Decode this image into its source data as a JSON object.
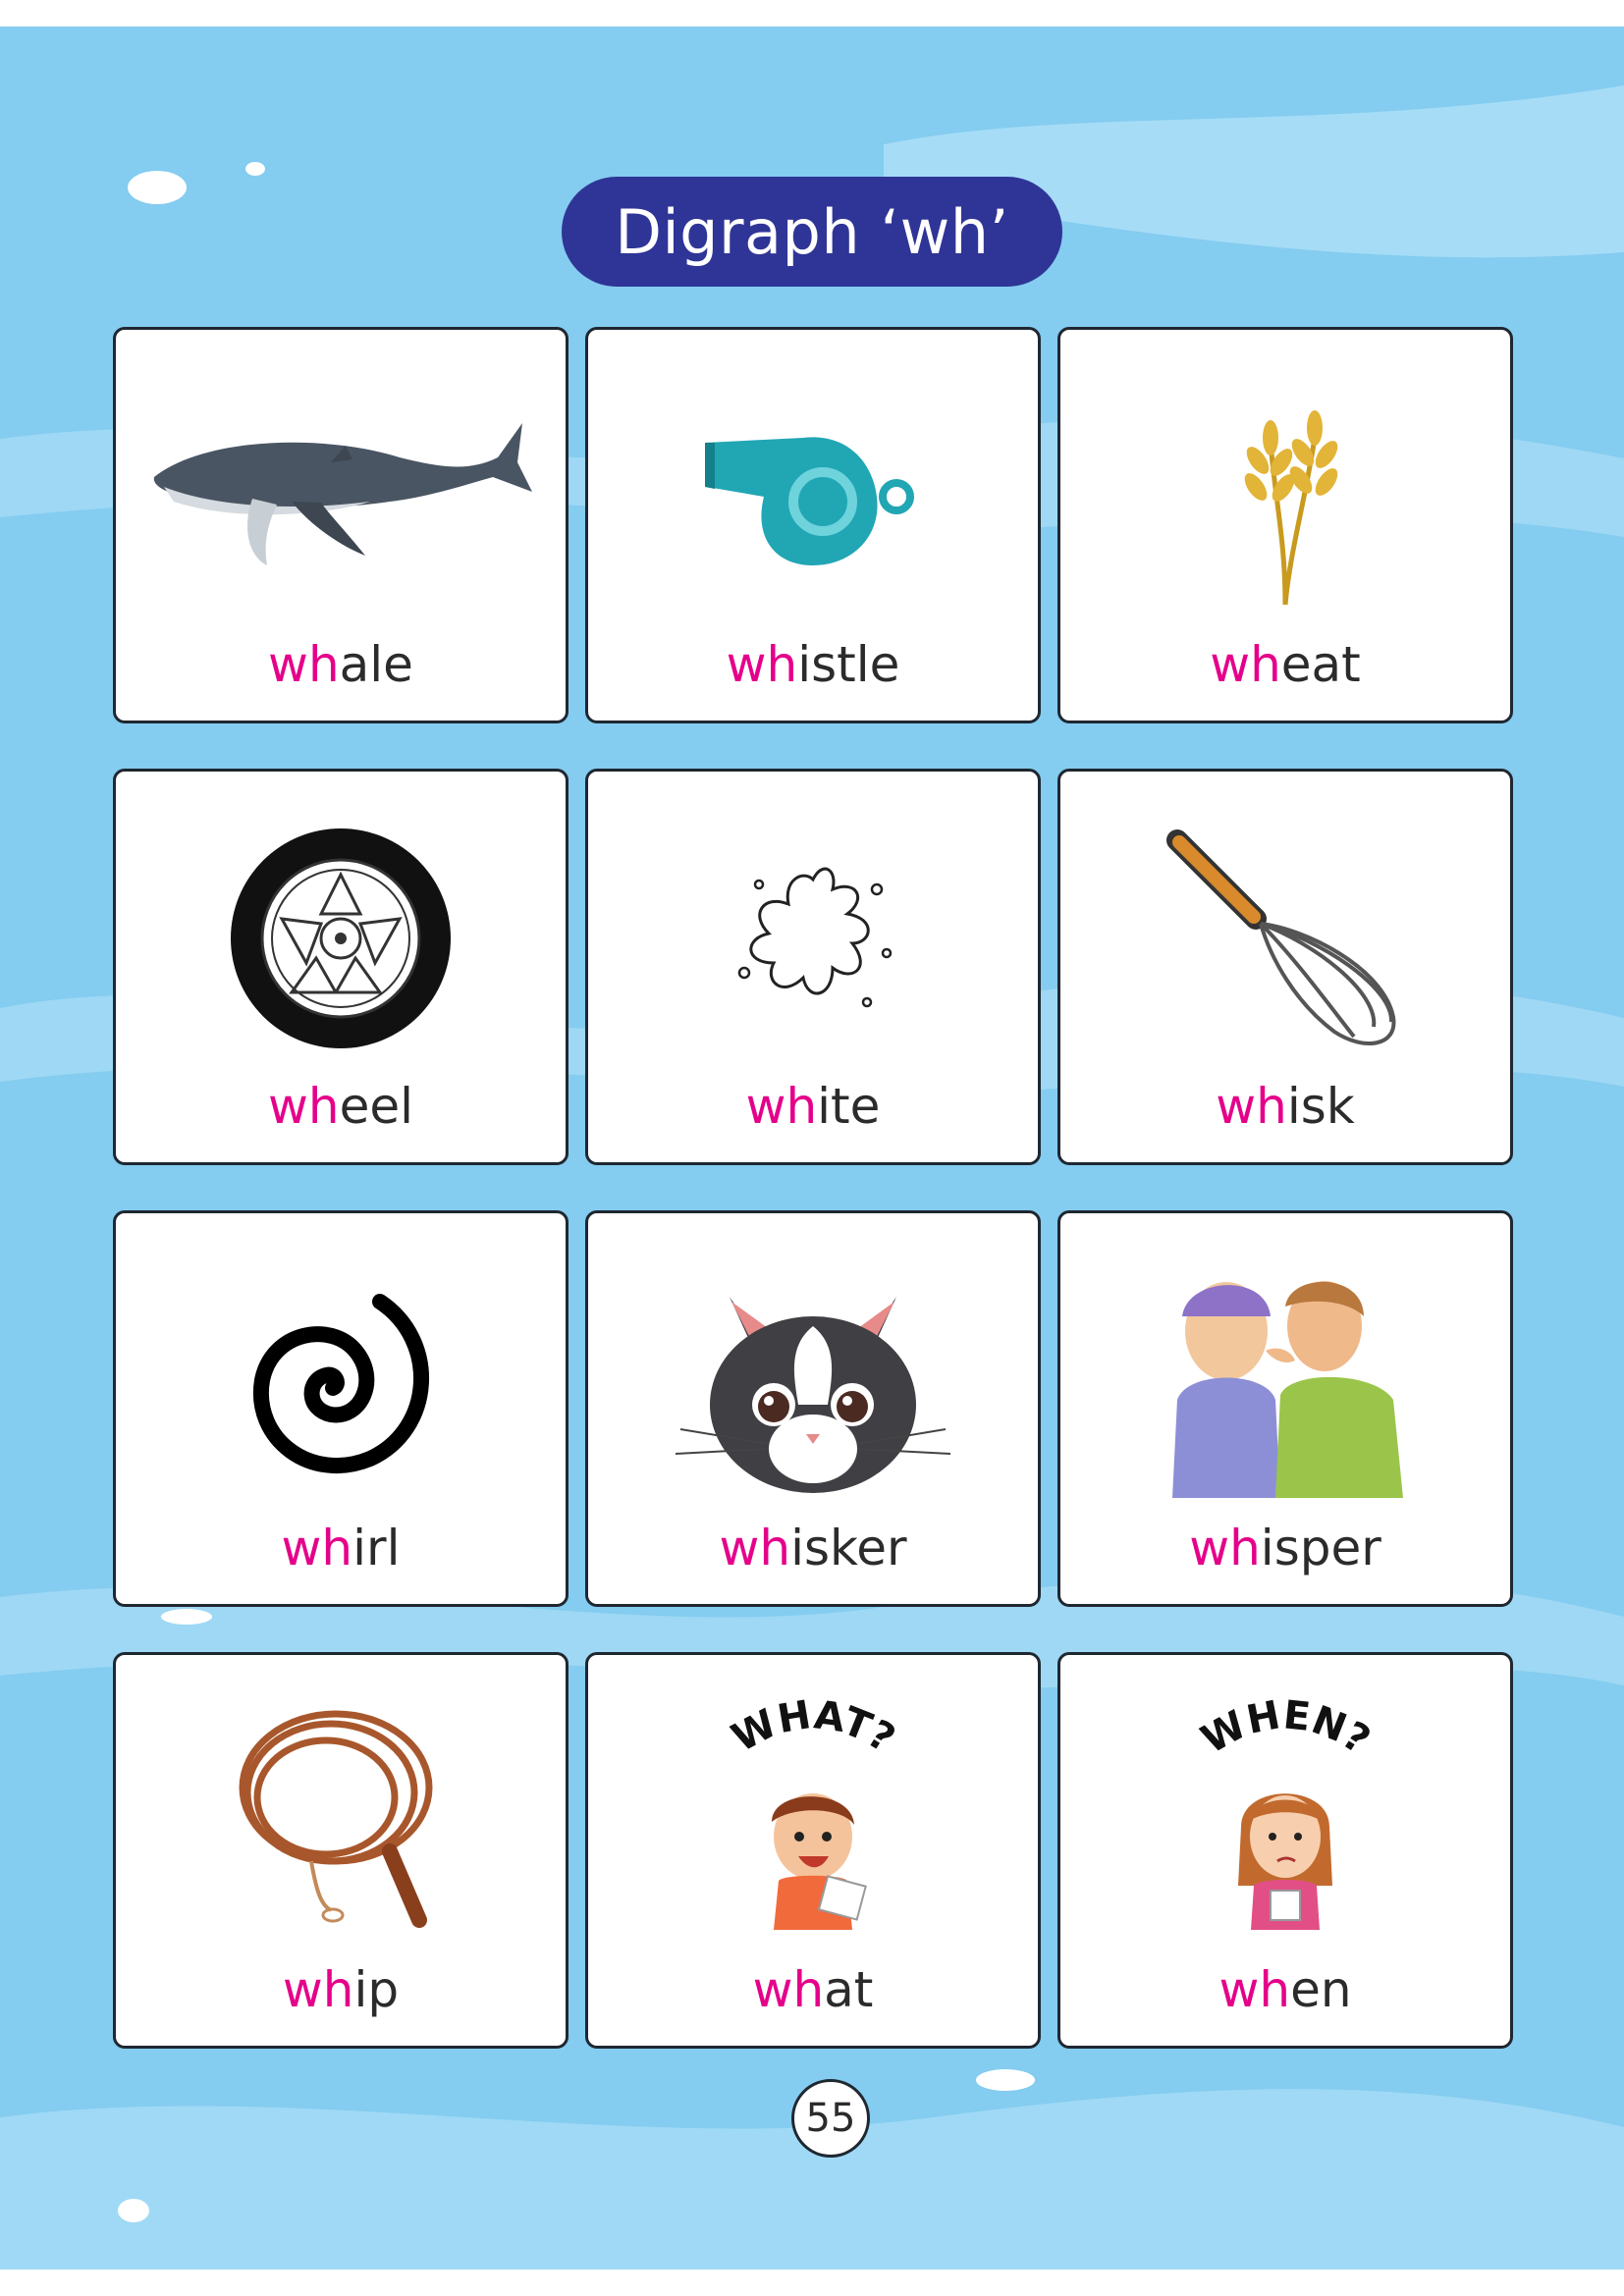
{
  "title": "Digraph ‘wh’",
  "digraph": "wh",
  "colors": {
    "background": "#84ccf0",
    "pill": "#2f3596",
    "highlight": "#e5008a"
  },
  "cards": [
    {
      "rest": "ale",
      "icon": "whale-icon"
    },
    {
      "rest": "istle",
      "icon": "whistle-icon"
    },
    {
      "rest": "eat",
      "icon": "wheat-icon"
    },
    {
      "rest": "eel",
      "icon": "wheel-icon"
    },
    {
      "rest": "ite",
      "icon": "white-splash-icon"
    },
    {
      "rest": "isk",
      "icon": "whisk-icon"
    },
    {
      "rest": "irl",
      "icon": "whirl-icon"
    },
    {
      "rest": "isker",
      "icon": "cat-whiskers-icon"
    },
    {
      "rest": "isper",
      "icon": "whisper-icon"
    },
    {
      "rest": "ip",
      "icon": "whip-icon"
    },
    {
      "rest": "at",
      "icon": "what-kid-icon",
      "caption": "WHAT?"
    },
    {
      "rest": "en",
      "icon": "when-girl-icon",
      "caption": "WHEN?"
    }
  ],
  "page_number": "55"
}
